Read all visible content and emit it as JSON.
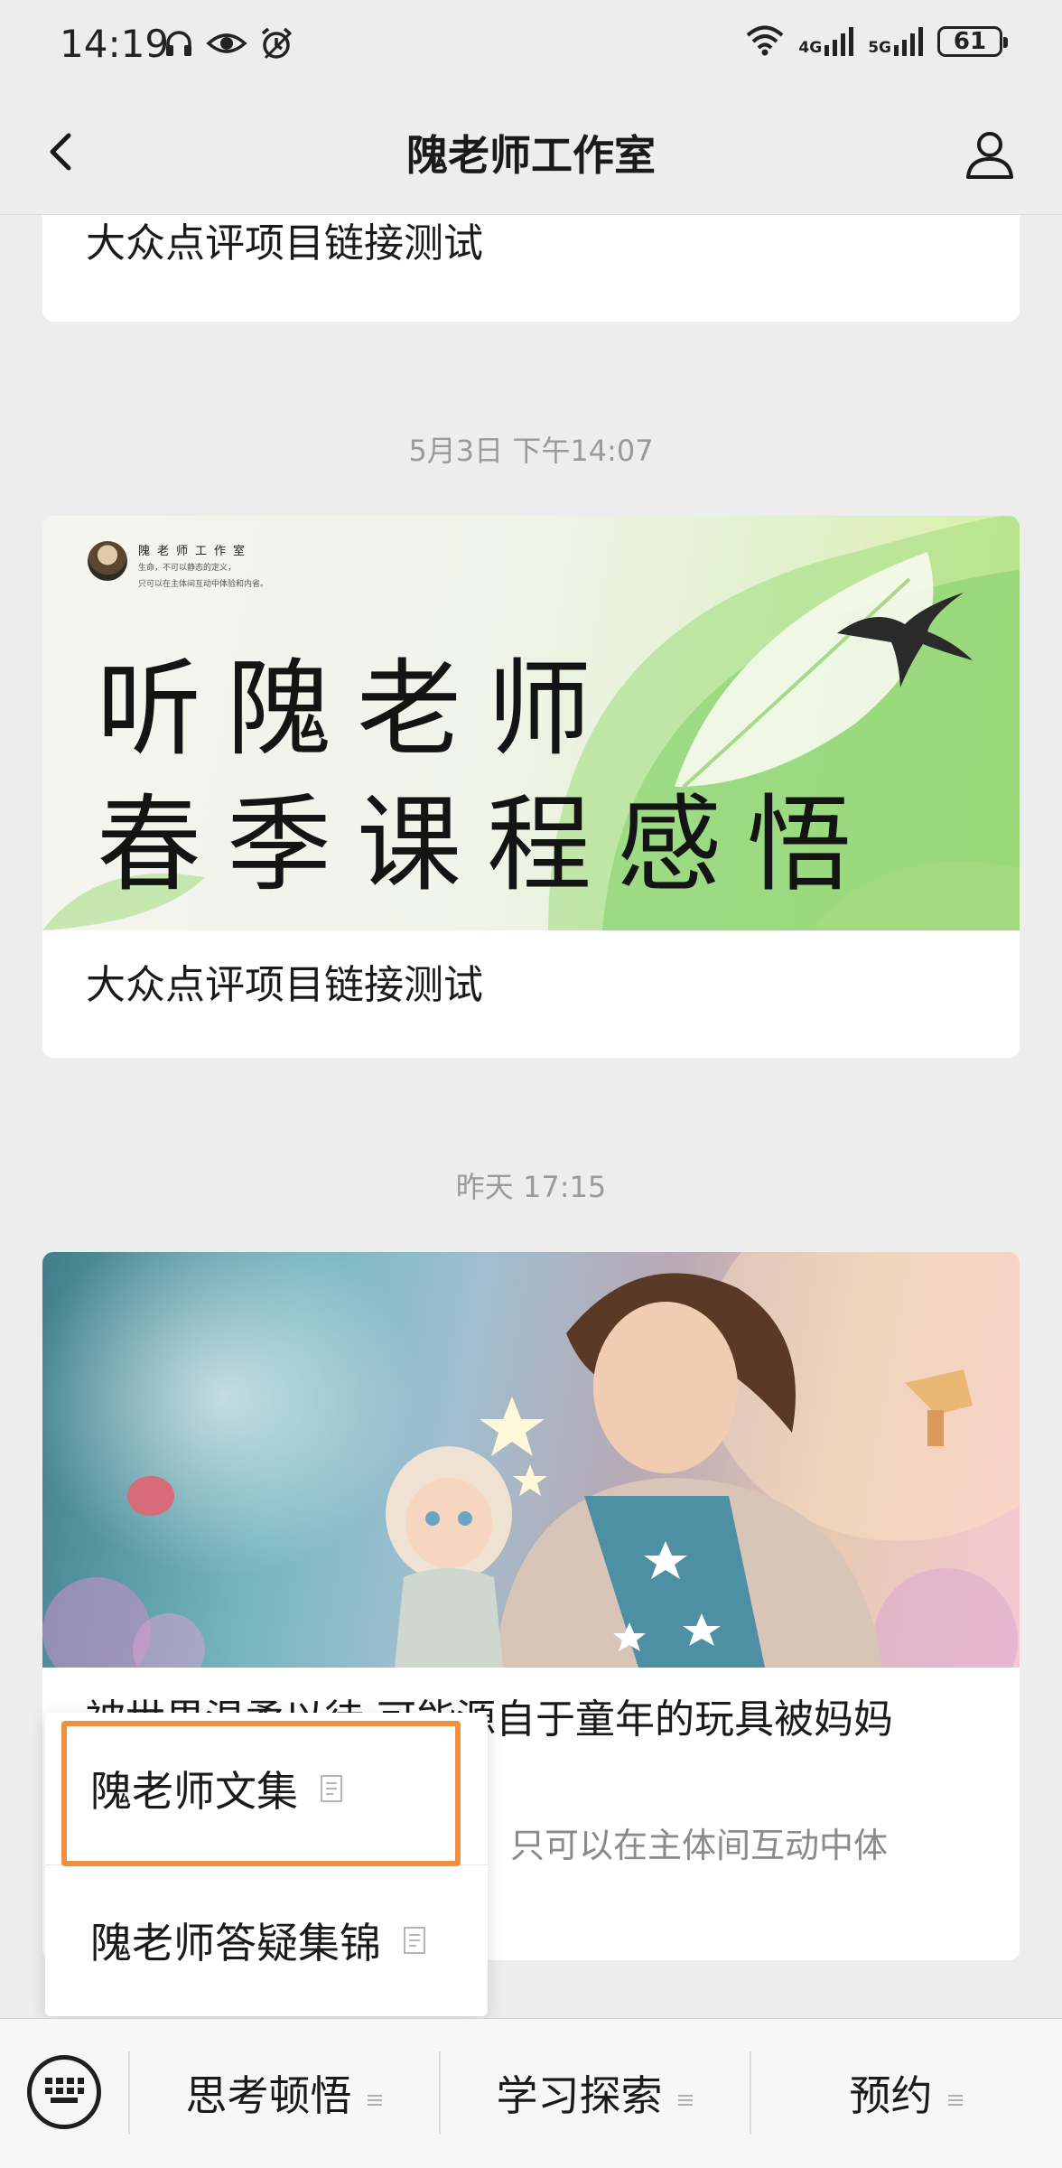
{
  "status_bar": {
    "time": "14:19",
    "net1": "4G",
    "net2": "5G",
    "battery": "61"
  },
  "nav": {
    "title": "隗老师工作室"
  },
  "feed": [
    {
      "title": "大众点评项目链接测试"
    },
    {
      "timestamp": "5月3日 下午14:07",
      "banner": {
        "brand_name": "隗老师工作室",
        "brand_quote_line1": "生命，不可以静态的定义，",
        "brand_quote_line2": "只可以在主体间互动中体验和内省。",
        "line1": "听隗老师",
        "line2": "春季课程感悟"
      },
      "title": "大众点评项目链接测试"
    },
    {
      "timestamp": "昨天 17:15",
      "title": "被世界温柔以待,可能源自于童年的玩具被妈妈",
      "summary": "，只可以在主体间互动中体"
    }
  ],
  "popup_menu": {
    "items": [
      {
        "label": "隗老师文集"
      },
      {
        "label": "隗老师答疑集锦"
      }
    ]
  },
  "bottom_menu": {
    "items": [
      {
        "label": "思考顿悟"
      },
      {
        "label": "学习探索"
      },
      {
        "label": "预约"
      }
    ]
  },
  "colors": {
    "highlight": "#ef8f3f",
    "background": "#ededed",
    "card": "#ffffff"
  }
}
